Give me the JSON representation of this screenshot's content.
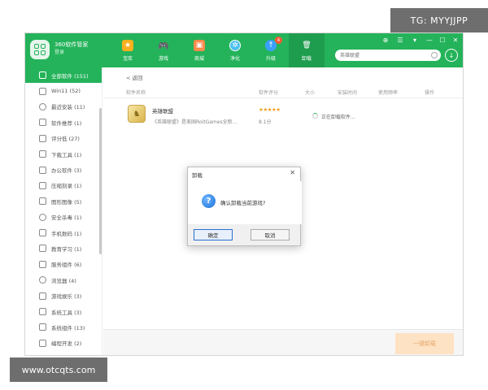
{
  "watermarks": {
    "top": "TG: MYYJJPP",
    "bottom": "www.otcqts.com"
  },
  "header": {
    "brand_name": "360软件管家",
    "brand_sub": "登录",
    "nav": [
      {
        "label": "宝库",
        "icon": "treasure-icon",
        "color": "#ffb01f"
      },
      {
        "label": "游戏",
        "icon": "gamepad-icon",
        "color": "#ffffff"
      },
      {
        "label": "商城",
        "icon": "shopping-bag-icon",
        "color": "#ff8a4a"
      },
      {
        "label": "净化",
        "icon": "purify-icon",
        "color": "#7fd4ff"
      },
      {
        "label": "升级",
        "icon": "upgrade-icon",
        "color": "#3aa0ff",
        "badge": "4"
      },
      {
        "label": "卸载",
        "icon": "trash-icon",
        "color": "#ffffff"
      }
    ],
    "search_placeholder": "英雄联盟"
  },
  "sidebar": {
    "items": [
      {
        "label": "全部软件 (151)"
      },
      {
        "label": "Win11 (52)"
      },
      {
        "label": "最近安装 (11)"
      },
      {
        "label": "软件推荐 (1)"
      },
      {
        "label": "评分低 (27)"
      },
      {
        "label": "下载工具 (1)"
      },
      {
        "label": "办公软件 (3)"
      },
      {
        "label": "压缩刻录 (1)"
      },
      {
        "label": "图形图像 (5)"
      },
      {
        "label": "安全杀毒 (1)"
      },
      {
        "label": "手机数码 (1)"
      },
      {
        "label": "教育学习 (1)"
      },
      {
        "label": "服务组件 (6)"
      },
      {
        "label": "浏览器 (4)"
      },
      {
        "label": "游戏娱乐 (3)"
      },
      {
        "label": "系统工具 (3)"
      },
      {
        "label": "系统组件 (13)"
      },
      {
        "label": "编程开发 (2)"
      }
    ]
  },
  "main": {
    "back_label": "< 返回",
    "columns": [
      "软件名称",
      "软件评分",
      "大小",
      "安装时间",
      "使用频率",
      "操作"
    ],
    "app": {
      "name": "英雄联盟",
      "desc": "《英雄联盟》是美国RoitGames全新...",
      "stars": "★★★★★",
      "score": "8.1分",
      "status": "正在卸载软件..."
    },
    "uninstall_all_label": "一键卸载"
  },
  "dialog": {
    "title": "卸载",
    "close": "✕",
    "message": "确认卸载当前游戏?",
    "ok_label": "确定",
    "cancel_label": "取消"
  },
  "window_controls": [
    "⊕",
    "☰",
    "▾",
    "—",
    "☐",
    "✕"
  ]
}
